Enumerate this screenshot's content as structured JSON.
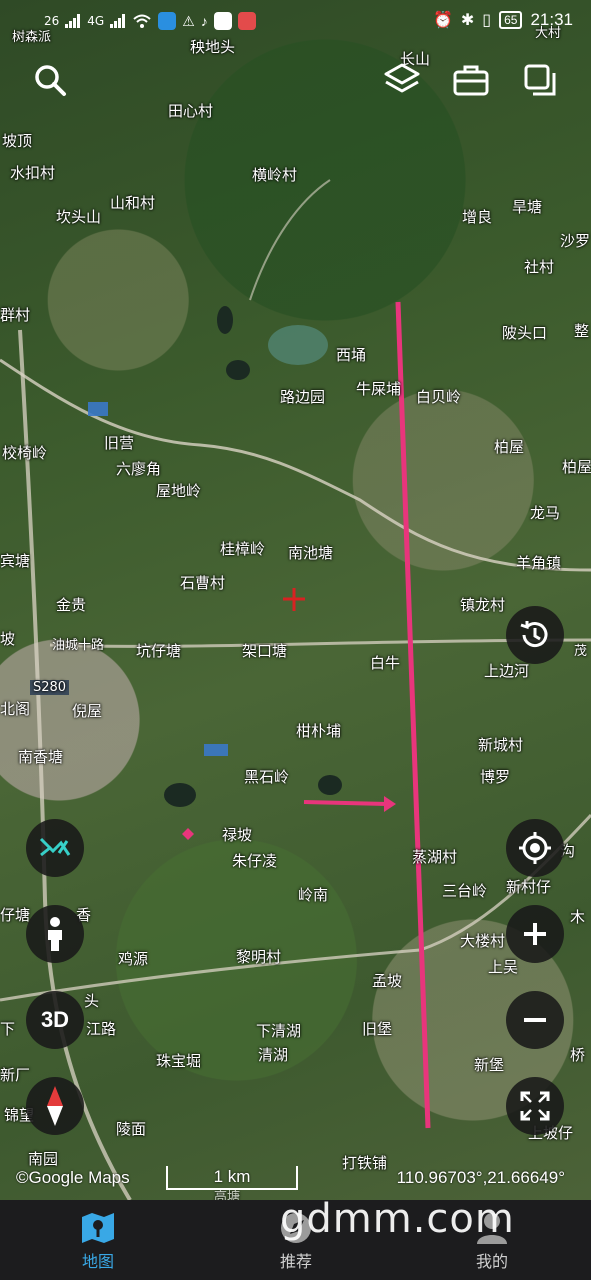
{
  "status_bar": {
    "network_left": "26",
    "network_right": "4G",
    "battery": "65",
    "time": "21:31"
  },
  "toolbar": {
    "search_icon": "search-icon",
    "layers_icon": "layers-icon",
    "toolbox_icon": "briefcase-icon",
    "copy_icon": "copy-icon"
  },
  "map": {
    "places": [
      "树森派",
      "秧地头",
      "长山",
      "大村",
      "田心村",
      "坡顶",
      "横岭村",
      "水扣村",
      "山和村",
      "坎头山",
      "增良",
      "旱塘",
      "沙罗",
      "社村",
      "群村",
      "陂头口",
      "整",
      "西埇",
      "牛屎埔",
      "白贝岭",
      "路边园",
      "旧营",
      "校椅岭",
      "柏屋",
      "六廖角",
      "屋地岭",
      "柏屋",
      "龙马",
      "宾塘",
      "桂樟岭",
      "南池塘",
      "羊角镇",
      "石曹村",
      "镇龙村",
      "金贵",
      "油城十路",
      "坑仔塘",
      "架口塘",
      "白牛",
      "坡",
      "茂",
      "上边河",
      "S280",
      "北阁",
      "倪屋",
      "柑朴埔",
      "新城村",
      "南香塘",
      "黑石岭",
      "博罗",
      "禄坡",
      "朱仔凌",
      "蒸湖村",
      "新村仔",
      "沟",
      "岭南",
      "三台岭",
      "木",
      "仔塘",
      "香",
      "大楼村",
      "鸡源",
      "黎明村",
      "上吴",
      "孟坡",
      "头",
      "江路",
      "下",
      "下清湖",
      "旧堡",
      "桥",
      "珠宝堀",
      "清湖",
      "新厂",
      "新堡",
      "锦望",
      "陵面",
      "上坡仔",
      "南园",
      "打铁铺",
      "高塘"
    ],
    "road_label": "S280"
  },
  "controls": {
    "history_icon": "history-icon",
    "route_icon": "route-icon",
    "person_icon": "pedestrian-icon",
    "view_3d": "3D",
    "compass_icon": "compass-icon",
    "locate_icon": "locate-icon",
    "zoom_in_icon": "plus-icon",
    "zoom_out_icon": "minus-icon",
    "fullscreen_icon": "fullscreen-icon"
  },
  "footer": {
    "attribution": "©Google Maps",
    "scale": "1 km",
    "coordinates": "110.96703°,21.66649°"
  },
  "nav": {
    "items": [
      {
        "label": "地图",
        "icon": "map-icon",
        "active": true
      },
      {
        "label": "推荐",
        "icon": "explore-icon",
        "active": false
      },
      {
        "label": "我的",
        "icon": "profile-icon",
        "active": false
      }
    ]
  },
  "watermark": "gdmm.com",
  "colors": {
    "accent": "#39a8e6",
    "annotation": "#e8357c",
    "nav_bg": "#1c1c1e"
  }
}
